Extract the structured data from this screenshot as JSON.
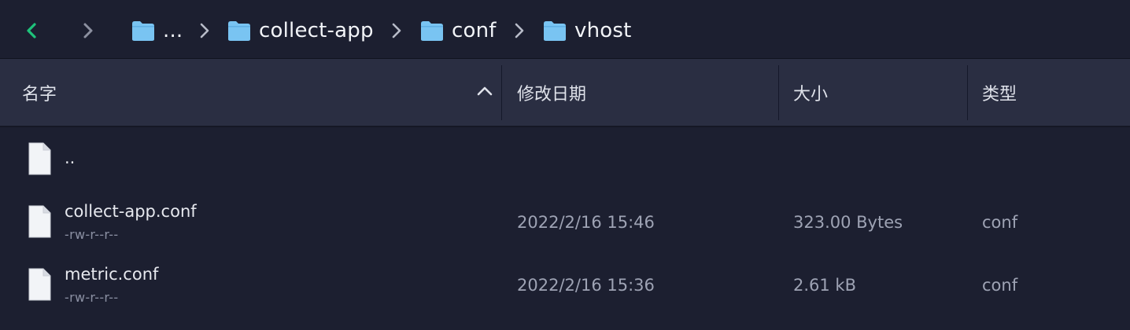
{
  "colors": {
    "accent_green": "#1ec27a",
    "folder_blue": "#79c4f2",
    "background": "#1c1f30",
    "header_background": "#2a2e42"
  },
  "breadcrumb": [
    {
      "label": "...",
      "icon": "folder-icon"
    },
    {
      "label": "collect-app",
      "icon": "folder-icon"
    },
    {
      "label": "conf",
      "icon": "folder-icon"
    },
    {
      "label": "vhost",
      "icon": "folder-icon"
    }
  ],
  "columns": {
    "name": "名字",
    "modified": "修改日期",
    "size": "大小",
    "type": "类型"
  },
  "sort": {
    "column": "name",
    "direction": "ascending"
  },
  "files": [
    {
      "name": "..",
      "permissions": "",
      "modified": "",
      "size": "",
      "type": "",
      "icon": "file-icon"
    },
    {
      "name": "collect-app.conf",
      "permissions": "-rw-r--r--",
      "modified": "2022/2/16 15:46",
      "size": "323.00 Bytes",
      "type": "conf",
      "icon": "file-icon"
    },
    {
      "name": "metric.conf",
      "permissions": "-rw-r--r--",
      "modified": "2022/2/16 15:36",
      "size": "2.61 kB",
      "type": "conf",
      "icon": "file-icon"
    }
  ]
}
